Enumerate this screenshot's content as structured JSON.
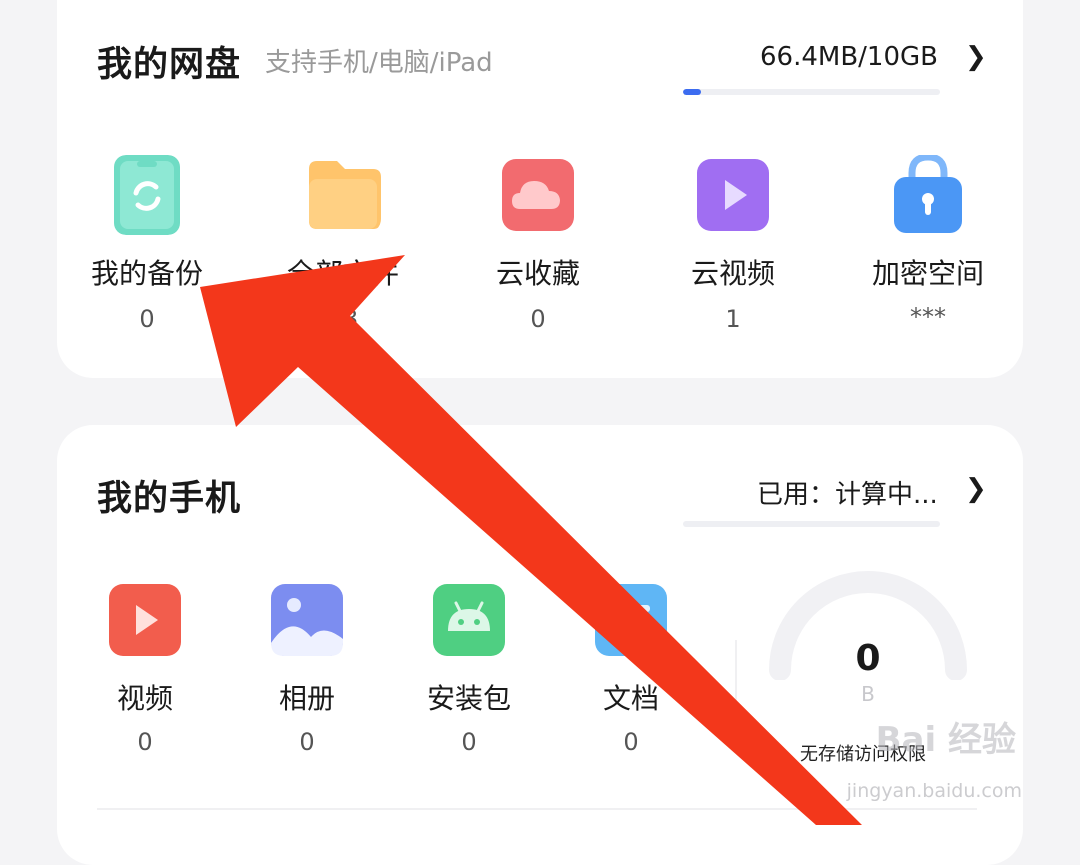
{
  "cloud": {
    "title": "我的网盘",
    "subtitle": "支持手机/电脑/iPad",
    "usage": "66.4MB/10GB",
    "usage_fraction": 0.007,
    "chevron": "❯",
    "tiles": [
      {
        "label": "我的备份",
        "count": "0",
        "icon": "phone-backup-icon",
        "color": "#6fdcc4"
      },
      {
        "label": "全部文件",
        "count": "23",
        "icon": "folder-icon",
        "color": "#ffc46b"
      },
      {
        "label": "云收藏",
        "count": "0",
        "icon": "cloud-icon",
        "color": "#f26b6f"
      },
      {
        "label": "云视频",
        "count": "1",
        "icon": "play-icon",
        "color": "#a06ef2"
      },
      {
        "label": "加密空间",
        "count": "***",
        "icon": "lock-icon",
        "color": "#4b97f5"
      }
    ]
  },
  "phone": {
    "title": "我的手机",
    "usage": "已用：计算中...",
    "usage_fraction": 0,
    "chevron": "❯",
    "tiles": [
      {
        "label": "视频",
        "count": "0",
        "icon": "video-icon",
        "color": "#f25d4d"
      },
      {
        "label": "相册",
        "count": "0",
        "icon": "photo-album-icon",
        "color": "#7c8df0"
      },
      {
        "label": "安装包",
        "count": "0",
        "icon": "android-icon",
        "color": "#4fcf82"
      },
      {
        "label": "文档",
        "count": "0",
        "icon": "document-icon",
        "color": "#5fb6f5"
      }
    ],
    "gauge": {
      "value": "0",
      "unit": "B",
      "caption": "无存储访问权限"
    }
  },
  "watermark": {
    "text": "Bai 经验",
    "url": "jingyan.baidu.com"
  },
  "annotation": {
    "color": "#f3371b"
  }
}
